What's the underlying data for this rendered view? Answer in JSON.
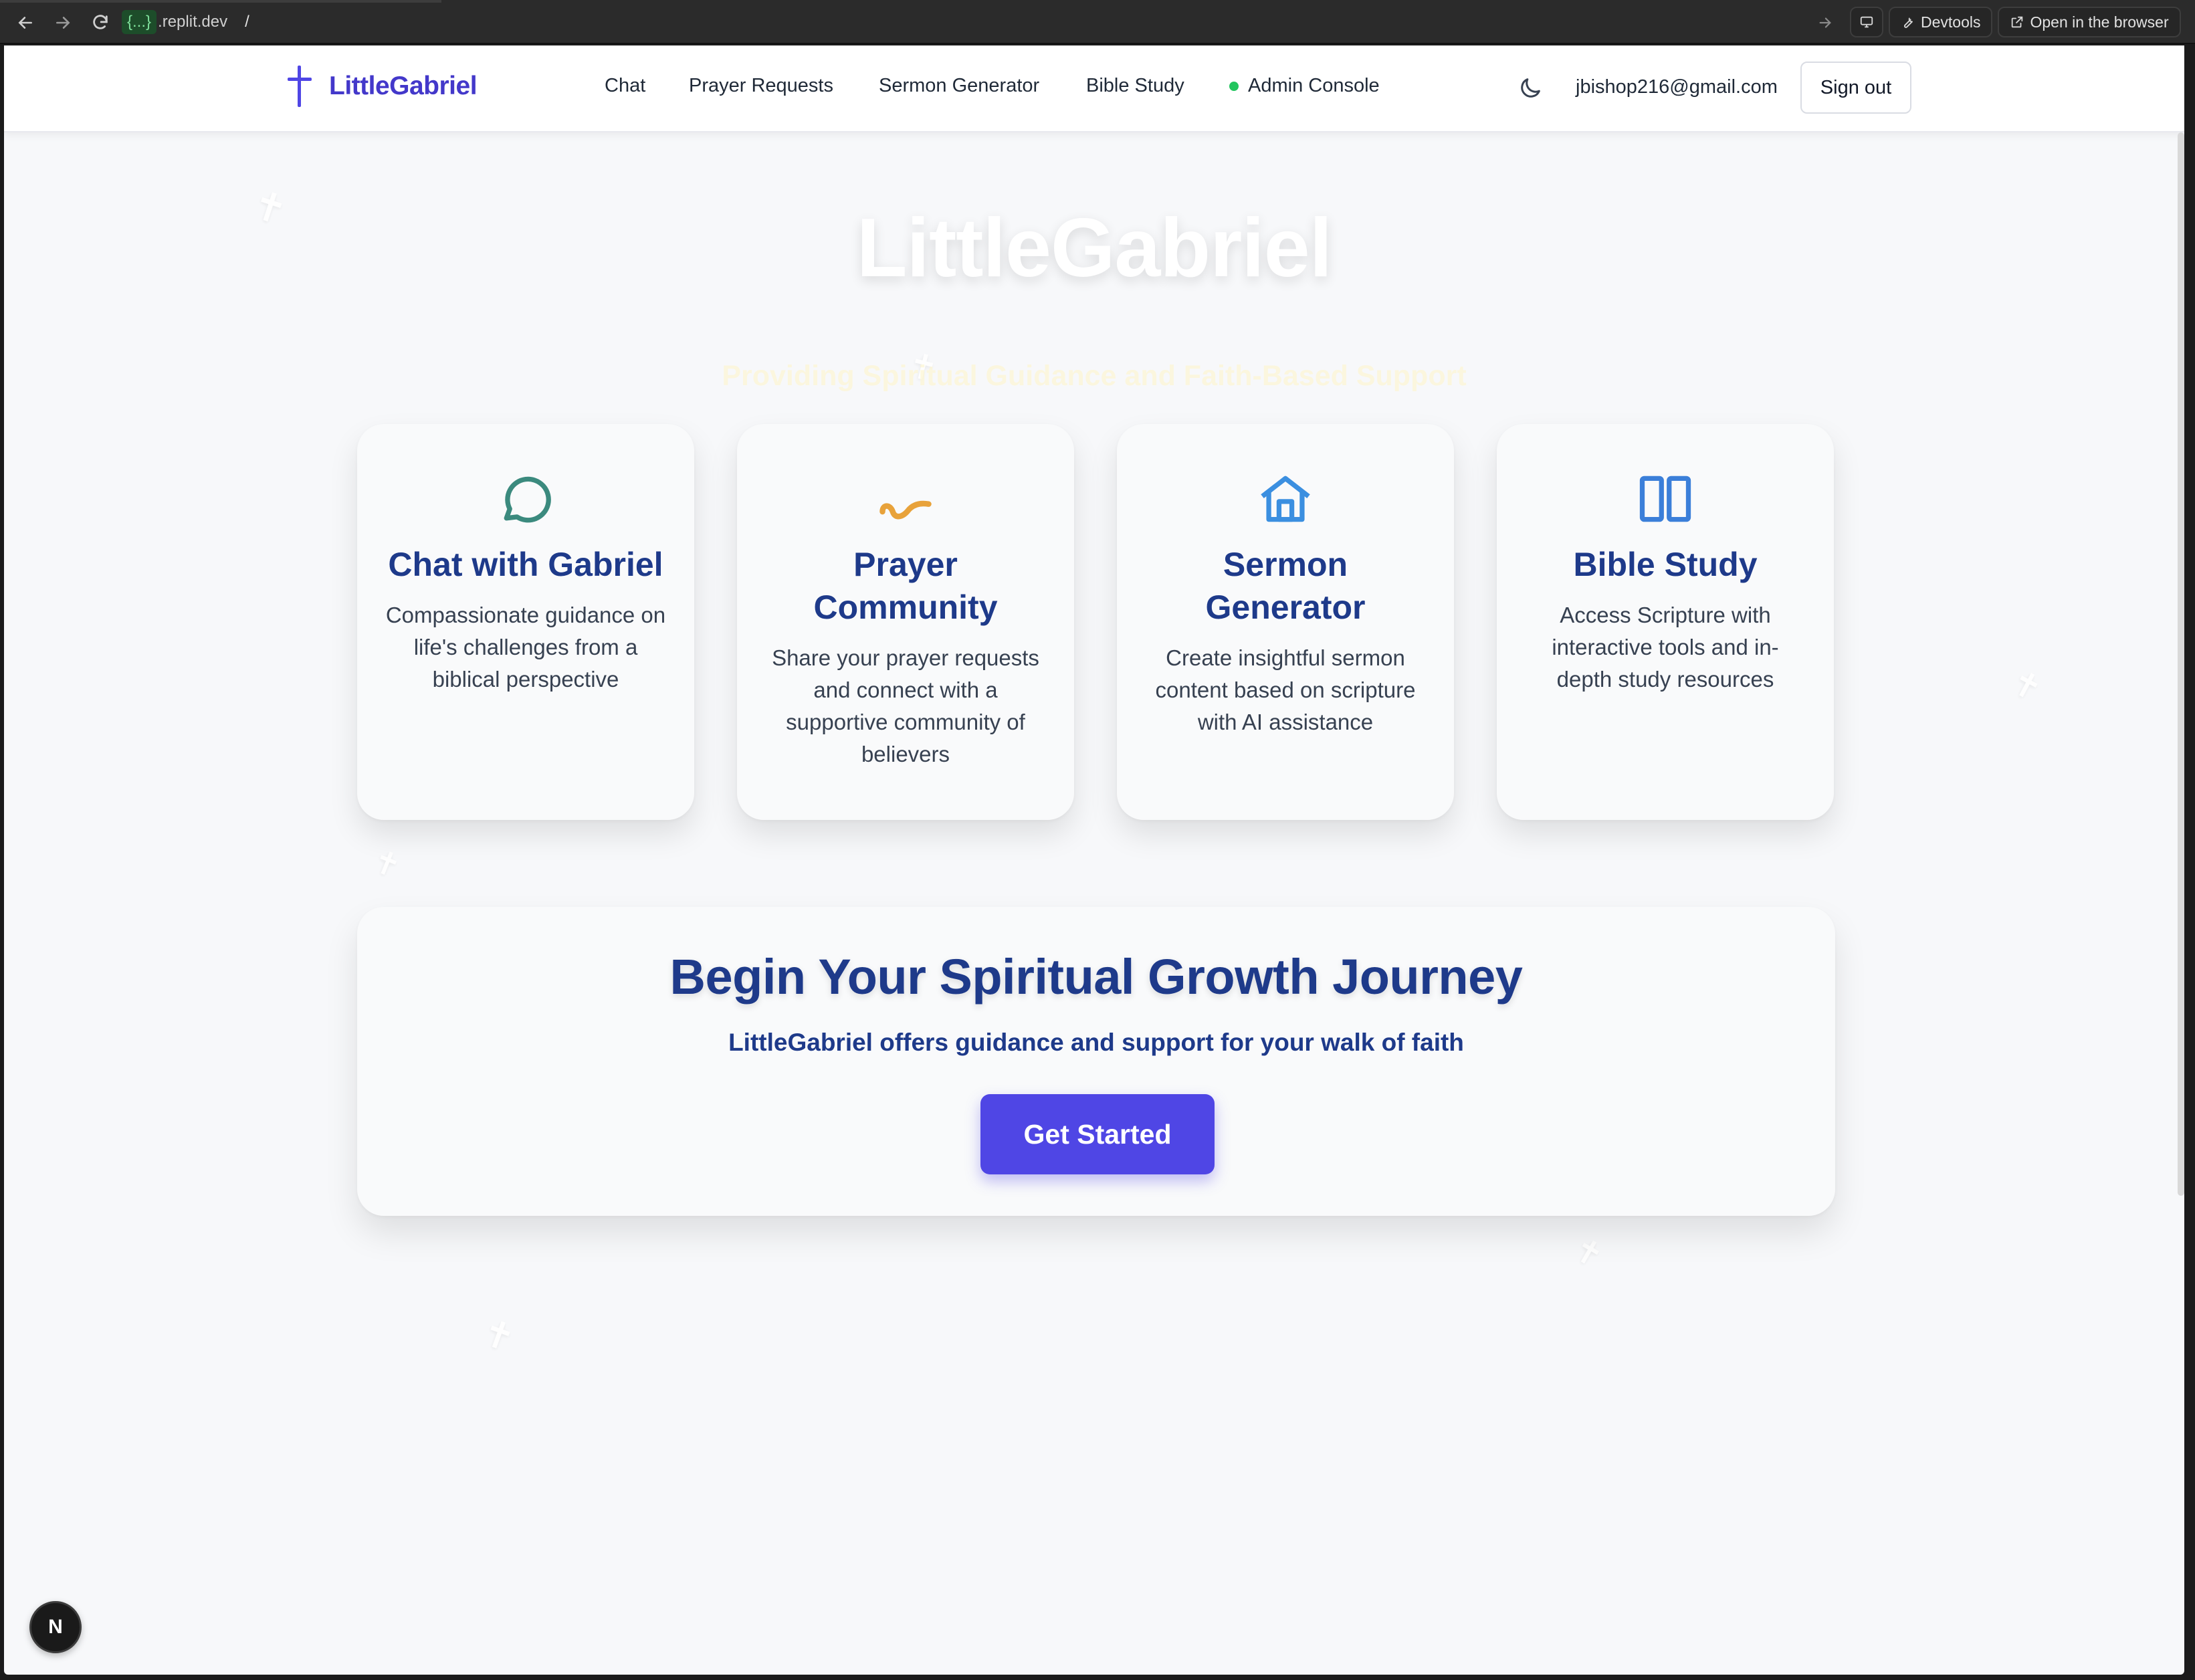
{
  "browser": {
    "url_highlight": "{...}",
    "url_host": ".replit.dev",
    "url_path": "/",
    "devtools_label": "Devtools",
    "open_browser_label": "Open in the browser"
  },
  "nav": {
    "brand": "LittleGabriel",
    "links": [
      "Chat",
      "Prayer Requests",
      "Sermon Generator",
      "Bible Study",
      "Admin Console"
    ],
    "email": "jbishop216@gmail.com",
    "signout_label": "Sign out"
  },
  "hero": {
    "title": "LittleGabriel",
    "subtitle": "Providing Spiritual Guidance and Faith-Based Support"
  },
  "cards": [
    {
      "icon": "chat-bubble-icon",
      "title": "Chat with Gabriel",
      "description": "Compassionate guidance on life's challenges from a biblical perspective",
      "color": "#3b8a7e"
    },
    {
      "icon": "squiggle-icon",
      "title": "Prayer Community",
      "description": "Share your prayer requests and connect with a supportive community of believers",
      "color": "#e8a23a"
    },
    {
      "icon": "church-home-icon",
      "title": "Sermon Generator",
      "description": "Create insightful sermon content based on scripture with AI assistance",
      "color": "#3b8fe0"
    },
    {
      "icon": "open-book-icon",
      "title": "Bible Study",
      "description": "Access Scripture with interactive tools and in-depth study resources",
      "color": "#3b7fd9"
    }
  ],
  "cta": {
    "title": "Begin Your Spiritual Growth Journey",
    "subtitle": "LittleGabriel offers guidance and support for your walk of faith",
    "button_label": "Get Started"
  },
  "badge": {
    "label": "N"
  },
  "colors": {
    "accent": "#4f46e5",
    "heading": "#1e3a8a",
    "background": "#f7f8fa"
  }
}
